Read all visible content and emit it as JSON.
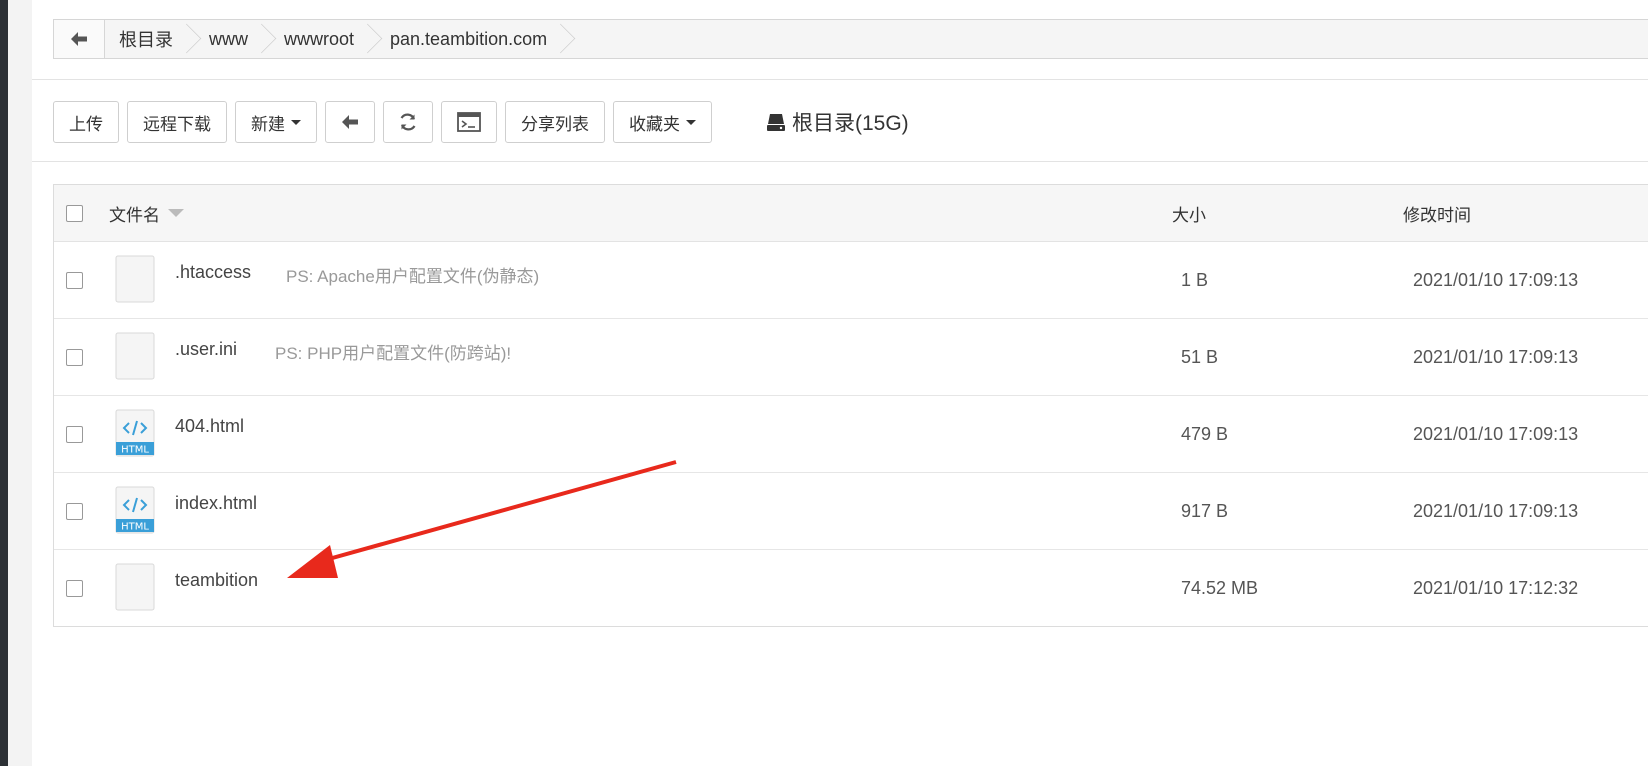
{
  "breadcrumb": {
    "back_icon": "arrow-left-icon",
    "items": [
      "根目录",
      "www",
      "wwwroot",
      "pan.teambition.com"
    ]
  },
  "toolbar": {
    "upload": "上传",
    "remote_download": "远程下载",
    "new": "新建",
    "back_icon": "arrow-left-icon",
    "refresh_icon": "refresh-icon",
    "terminal_icon": "terminal-icon",
    "share_list": "分享列表",
    "favorites": "收藏夹",
    "disk_label": "根目录(15G)"
  },
  "table": {
    "headers": {
      "name": "文件名",
      "size": "大小",
      "modified": "修改时间"
    },
    "rows": [
      {
        "name": ".htaccess",
        "note": "PS: Apache用户配置文件(伪静态)",
        "size": "1 B",
        "modified": "2021/01/10 17:09:13",
        "icon": "file-icon"
      },
      {
        "name": ".user.ini",
        "note": "PS: PHP用户配置文件(防跨站)!",
        "size": "51 B",
        "modified": "2021/01/10 17:09:13",
        "icon": "file-icon"
      },
      {
        "name": "404.html",
        "note": "",
        "size": "479 B",
        "modified": "2021/01/10 17:09:13",
        "icon": "html-file-icon"
      },
      {
        "name": "index.html",
        "note": "",
        "size": "917 B",
        "modified": "2021/01/10 17:09:13",
        "icon": "html-file-icon"
      },
      {
        "name": "teambition",
        "note": "",
        "size": "74.52 MB",
        "modified": "2021/01/10 17:12:32",
        "icon": "file-icon"
      }
    ]
  },
  "html_badge": "HTML",
  "colors": {
    "arrow": "#e8291c",
    "html_icon": "#3a9fd8"
  }
}
